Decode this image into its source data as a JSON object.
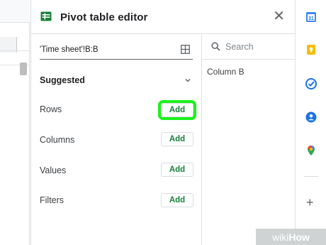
{
  "editor": {
    "title": "Pivot table editor",
    "close_label": "✕",
    "range": "'Time sheet'!B:B",
    "suggested_label": "Suggested",
    "sections": [
      {
        "label": "Rows",
        "button": "Add",
        "highlighted": true
      },
      {
        "label": "Columns",
        "button": "Add",
        "highlighted": false
      },
      {
        "label": "Values",
        "button": "Add",
        "highlighted": false
      },
      {
        "label": "Filters",
        "button": "Add",
        "highlighted": false
      }
    ],
    "search_placeholder": "Search",
    "fields": [
      "Column B"
    ]
  },
  "sidebar": {
    "icons": [
      "calendar-icon",
      "keep-icon",
      "tasks-icon",
      "contacts-icon",
      "maps-icon"
    ],
    "add_label": "+"
  },
  "watermark": {
    "wiki": "wiki",
    "how": "How"
  },
  "colors": {
    "accent_green": "#188038",
    "highlight": "#1bf21b"
  }
}
